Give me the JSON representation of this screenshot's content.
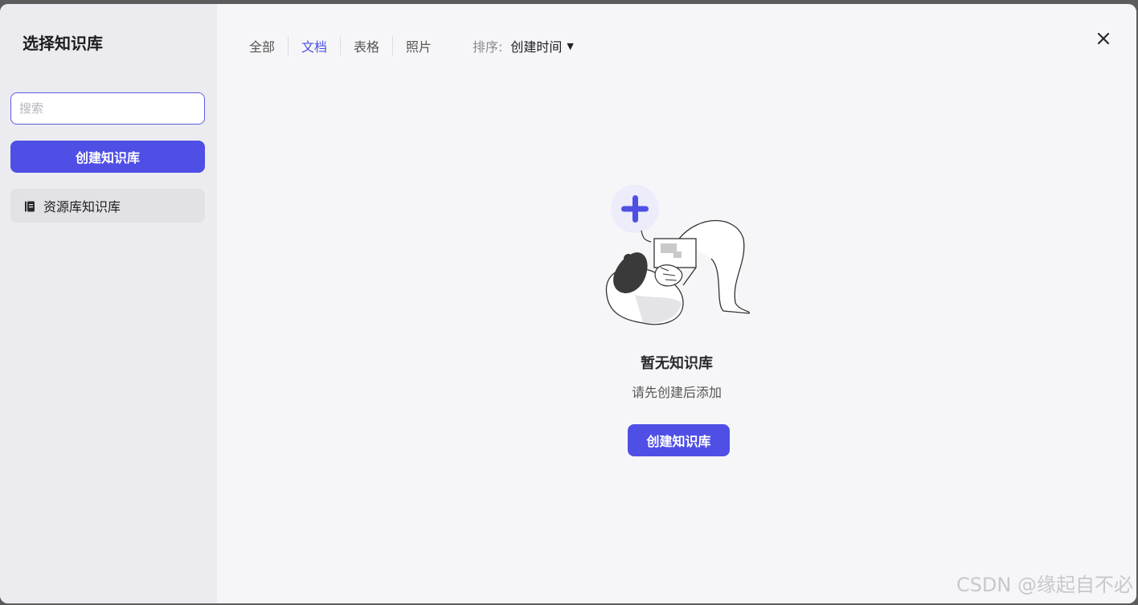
{
  "sidebar": {
    "title": "选择知识库",
    "search_placeholder": "搜索",
    "create_label": "创建知识库",
    "items": [
      {
        "label": "资源库知识库",
        "icon": "notebook-icon"
      }
    ]
  },
  "tabs": [
    {
      "label": "全部",
      "active": false
    },
    {
      "label": "文档",
      "active": true
    },
    {
      "label": "表格",
      "active": false
    },
    {
      "label": "照片",
      "active": false
    }
  ],
  "sort": {
    "label": "排序:",
    "value": "创建时间"
  },
  "empty": {
    "title": "暂无知识库",
    "subtitle": "请先创建后添加",
    "create_label": "创建知识库"
  },
  "watermark": "CSDN @缘起自不必",
  "colors": {
    "accent": "#4f4fe6",
    "sidebar_bg": "#ececf0",
    "main_bg": "#f6f6f8"
  }
}
